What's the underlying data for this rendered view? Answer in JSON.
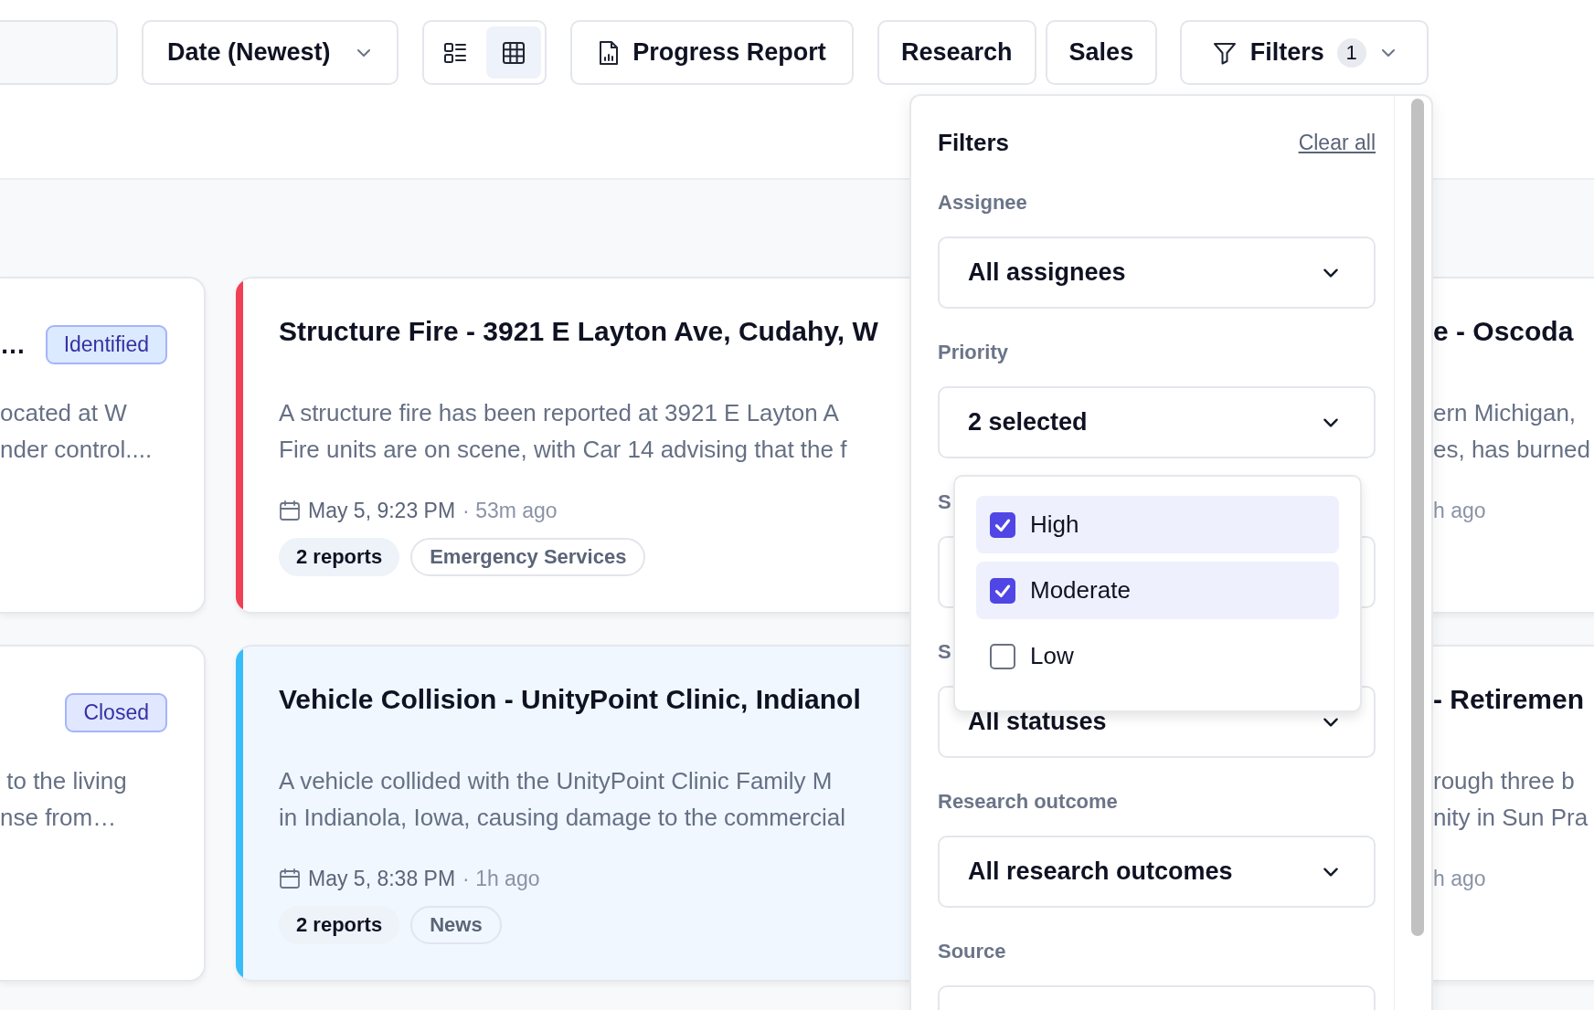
{
  "toolbar": {
    "sort": "Date (Newest)",
    "view_modes": [
      {
        "kind": "list",
        "selected": false
      },
      {
        "kind": "grid",
        "selected": true
      }
    ],
    "buttons": [
      {
        "label": "Progress Report",
        "kind": "report"
      },
      {
        "label": "Research",
        "kind": "plain"
      },
      {
        "label": "Sales",
        "kind": "plain"
      }
    ],
    "filters": {
      "label": "Filters",
      "count": "1"
    }
  },
  "card_rows": [
    {
      "left": {
        "title": "…",
        "badge": "Identified",
        "color": "#dbeafe",
        "description_lines": [
          "ocated at W",
          "nder control...."
        ]
      },
      "main": {
        "title": "Structure Fire - 3921 E Layton Ave, Cudahy, W",
        "color": "#ef4056",
        "selected": false,
        "description_lines": [
          "A structure fire has been reported at 3921 E Layton A",
          "Fire units are on scene, with Car 14 advising that the f"
        ],
        "date": "May 5, 9:23 PM",
        "ago": "· 53m ago",
        "chips": [
          {
            "label": "2 reports",
            "kind": "count"
          },
          {
            "label": "Emergency Services",
            "kind": "category"
          }
        ]
      },
      "right": {
        "title": "e - Oscoda",
        "description_lines": [
          "ern Michigan,",
          "es, has burned"
        ],
        "ago": "h ago"
      }
    },
    {
      "left": {
        "badge": "Closed",
        "color": "#e0e7ff",
        "description_lines": [
          " to the living",
          "nse from…"
        ]
      },
      "main": {
        "title": "Vehicle Collision - UnityPoint Clinic, Indianol",
        "color": "#38bdf8",
        "selected": true,
        "description_lines": [
          "A vehicle collided with the UnityPoint Clinic Family M",
          "in Indianola, Iowa, causing damage to the commercial"
        ],
        "date": "May 5, 8:38 PM",
        "ago": "· 1h ago",
        "chips": [
          {
            "label": "2 reports",
            "kind": "count"
          },
          {
            "label": "News",
            "kind": "category"
          }
        ]
      },
      "right": {
        "title": "- Retiremen",
        "description_lines": [
          "rough three b",
          "nity in Sun Pra"
        ],
        "ago": "h ago"
      }
    }
  ],
  "filter_panel": {
    "title": "Filters",
    "clear": "Clear all",
    "groups": [
      {
        "label": "Assignee",
        "value": "All assignees"
      },
      {
        "label": "Priority",
        "value": "2 selected"
      },
      {
        "label": "S"
      },
      {
        "label": "S",
        "value": "All statuses"
      },
      {
        "label": "Research outcome",
        "value": "All research outcomes"
      },
      {
        "label": "Source"
      }
    ],
    "priority_options": [
      {
        "label": "High",
        "checked": true
      },
      {
        "label": "Moderate",
        "checked": true
      },
      {
        "label": "Low",
        "checked": false
      }
    ]
  }
}
